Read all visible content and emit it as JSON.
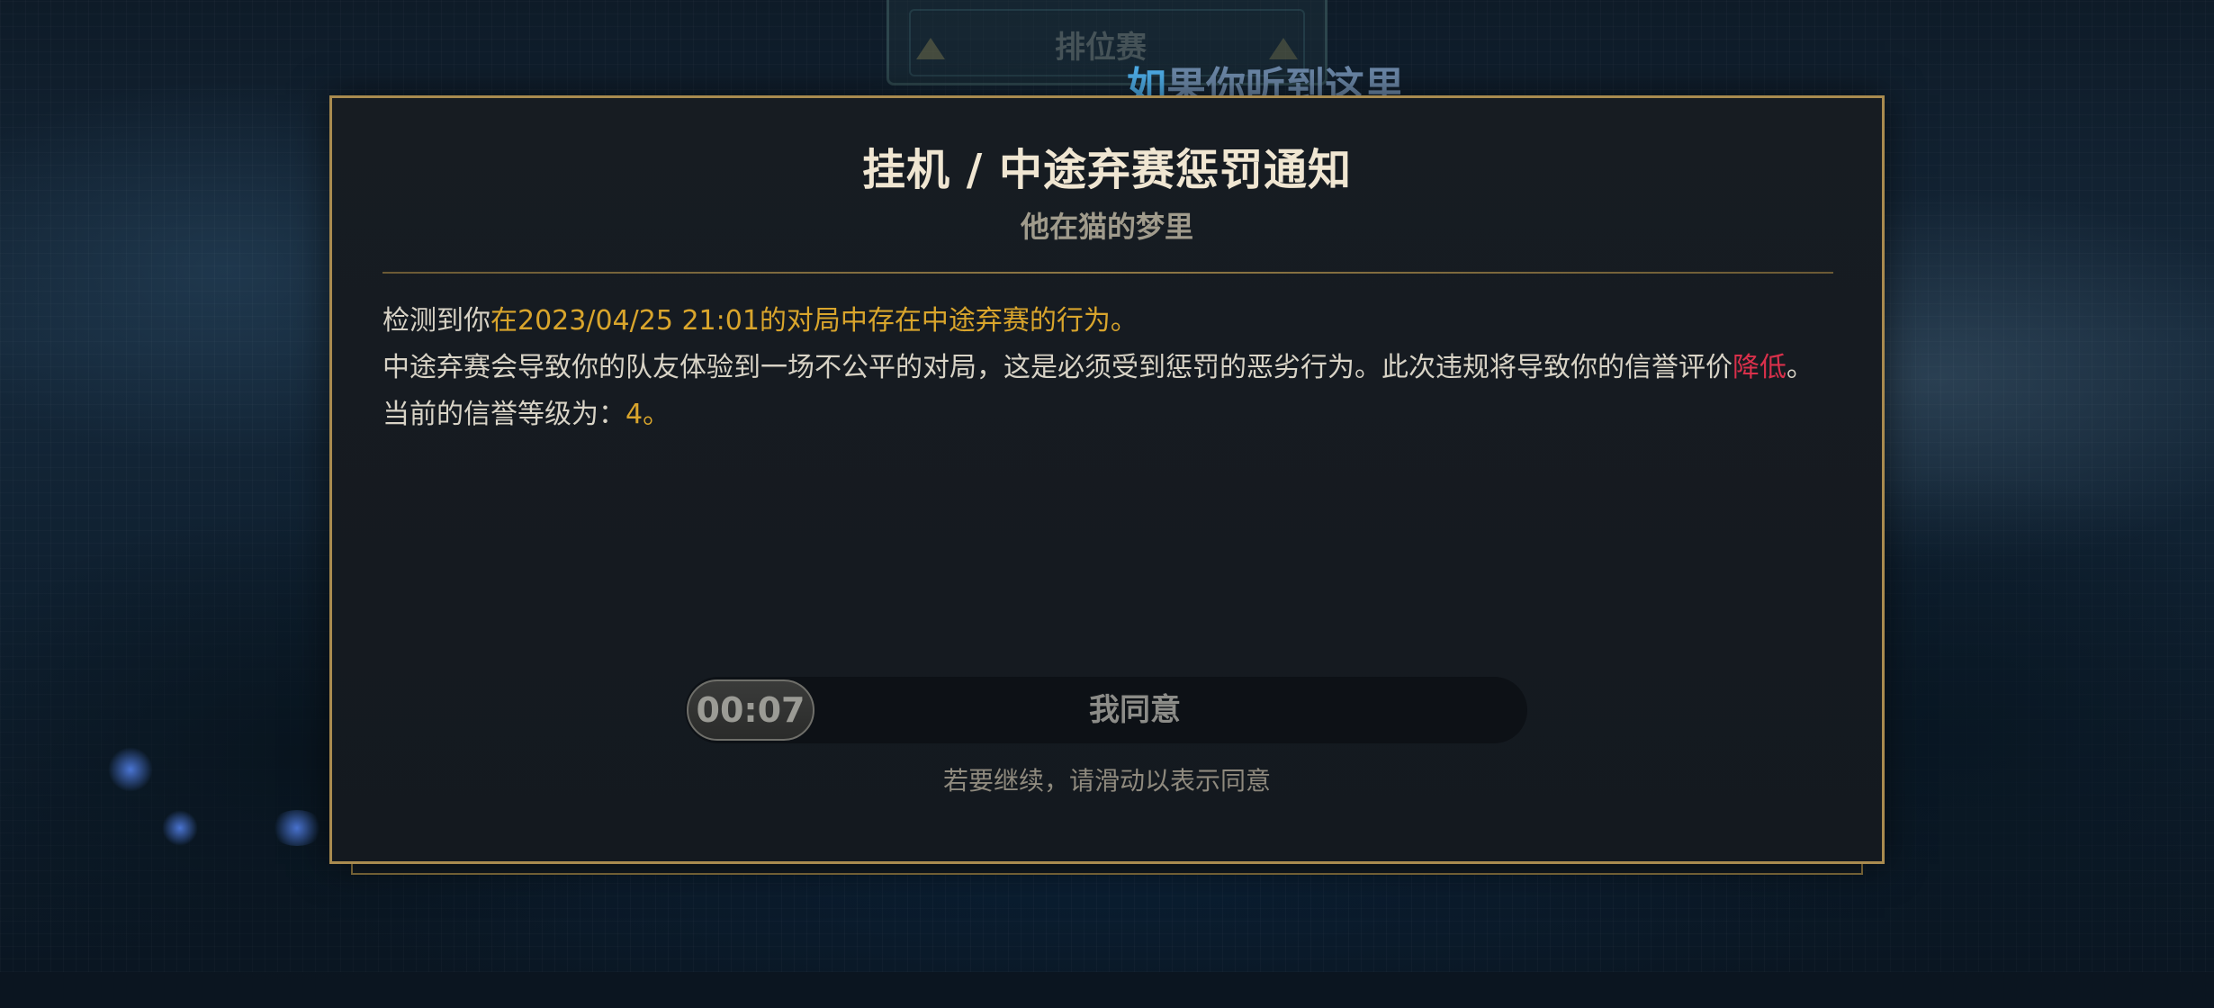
{
  "background": {
    "watermark_id": "4377618",
    "top_panel_text": "排位赛",
    "lyric": {
      "highlighted": "如",
      "rest": "果你听到这里"
    }
  },
  "dialog": {
    "title": "挂机 / 中途弃赛惩罚通知",
    "subtitle": "他在猫的梦里",
    "line1_prefix": "检测到你",
    "line1_highlight": "在2023/04/25 21:01的对局中存在中途弃赛的行为。",
    "line2_text": "中途弃赛会导致你的队友体验到一场不公平的对局，这是必须受到惩罚的恶劣行为。此次违规将导致你的信誉评价",
    "line2_highlight": "降低",
    "line2_suffix": "。",
    "line3_prefix": "当前的信誉等级为：",
    "honor_level": "4。",
    "slider": {
      "countdown": "00:07",
      "label": "我同意"
    },
    "hint": "若要继续，请滑动以表示同意"
  },
  "colors": {
    "gold_highlight": "#d9a52c",
    "red_highlight": "#d9304b",
    "frame_gold": "#a98b4f",
    "title": "#f0e6d2",
    "lyric_highlight": "#4fb0ec"
  }
}
